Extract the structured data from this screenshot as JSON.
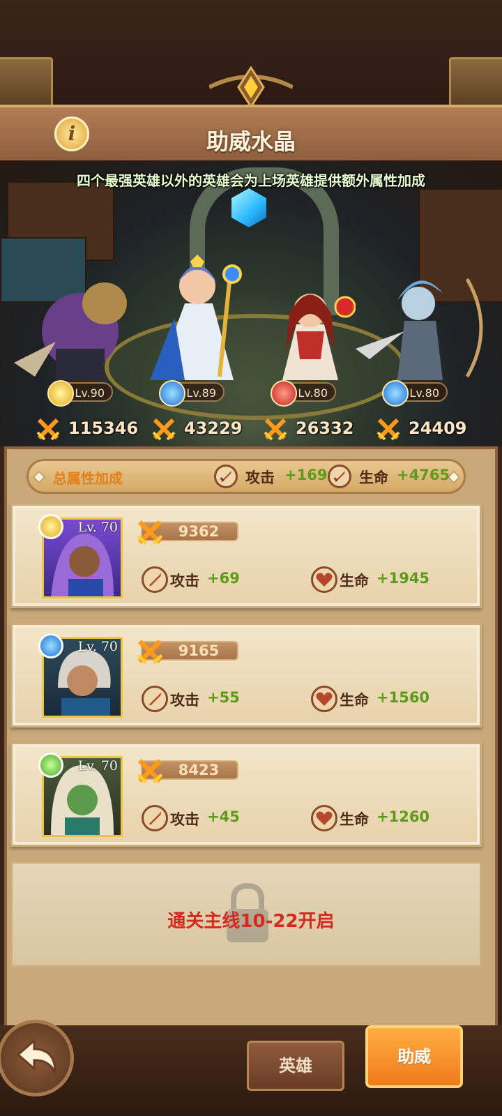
{
  "header": {
    "title": "助威水晶",
    "info_icon": "i"
  },
  "scene": {
    "subtitle": "四个最强英雄以外的英雄会为上场英雄提供额外属性加成",
    "heroes": [
      {
        "level": "Lv.90",
        "power": "115346",
        "gem": "gold"
      },
      {
        "level": "Lv.89",
        "power": "43229",
        "gem": "blue"
      },
      {
        "level": "Lv.80",
        "power": "26332",
        "gem": "red"
      },
      {
        "level": "Lv.80",
        "power": "24409",
        "gem": "blue"
      }
    ]
  },
  "total": {
    "label": "总属性加成",
    "attack_label": "攻击",
    "attack_value": "+169",
    "hp_label": "生命",
    "hp_value": "+4765"
  },
  "support_slots": [
    {
      "level": "Lv. 70",
      "power": "9362",
      "attack_label": "攻击",
      "attack_value": "+69",
      "hp_label": "生命",
      "hp_value": "+1945",
      "gem": "gold"
    },
    {
      "level": "Lv. 70",
      "power": "9165",
      "attack_label": "攻击",
      "attack_value": "+55",
      "hp_label": "生命",
      "hp_value": "+1560",
      "gem": "blue"
    },
    {
      "level": "Lv. 70",
      "power": "8423",
      "attack_label": "攻击",
      "attack_value": "+45",
      "hp_label": "生命",
      "hp_value": "+1260",
      "gem": "green"
    }
  ],
  "locked_slot": {
    "text": "通关主线10-22开启"
  },
  "tabs": {
    "hero": "英雄",
    "cheer": "助威"
  },
  "colors": {
    "accent": "#f07a1a",
    "stat_green": "#5f9a1c",
    "lock_red": "#d42a1e"
  }
}
